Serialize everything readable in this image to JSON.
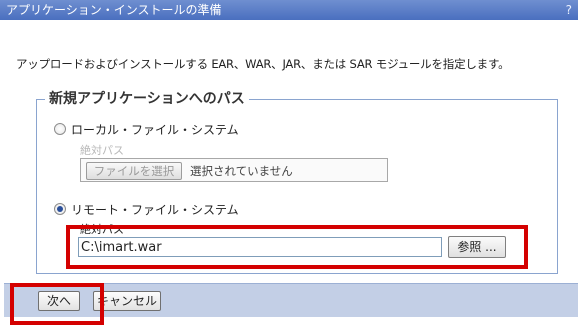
{
  "window": {
    "title": "アプリケーション・インストールの準備",
    "help_icon": "?"
  },
  "intro_text": "アップロードおよびインストールする EAR、WAR、JAR、または SAR モジュールを指定します。",
  "path_section": {
    "legend": "新規アプリケーションへのパス",
    "local": {
      "label": "ローカル・ファイル・システム",
      "selected": false,
      "path_label": "絶対パス",
      "file_button": "ファイルを選択",
      "file_status": "選択されていません"
    },
    "remote": {
      "label": "リモート・ファイル・システム",
      "selected": true,
      "path_label": "絶対パス",
      "path_value": "C:\\imart.war",
      "browse_button": "参照 ..."
    }
  },
  "footer": {
    "next_button": "次へ",
    "cancel_button": "キャンセル"
  },
  "colors": {
    "title_bar": "#4a6fbf",
    "footer": "#c3cfe6",
    "highlight": "#d40000"
  }
}
